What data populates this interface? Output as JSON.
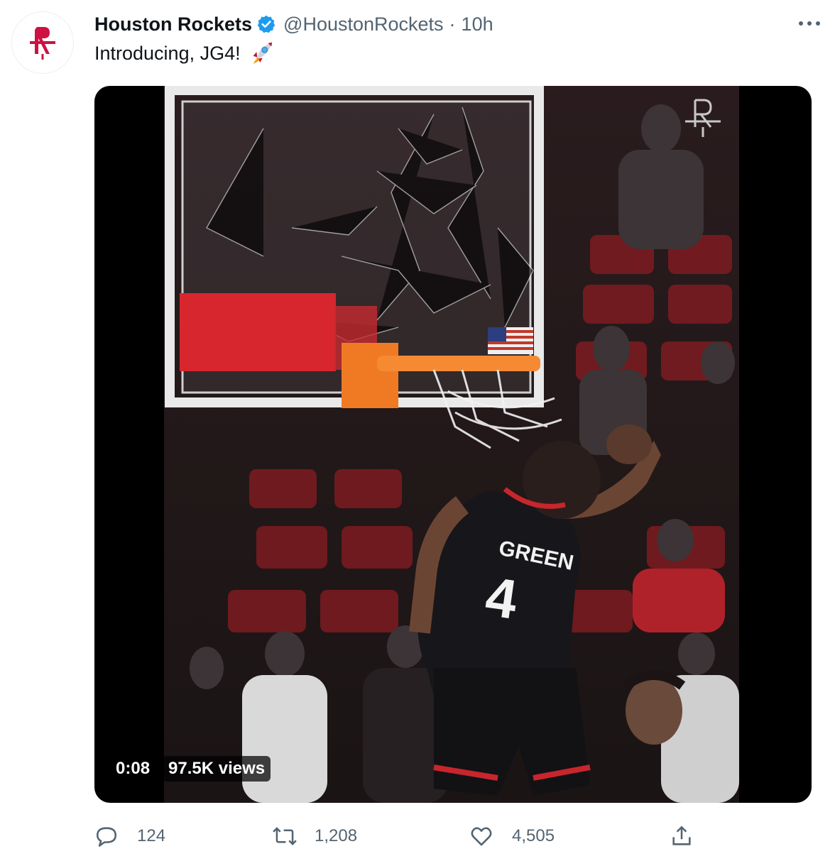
{
  "tweet": {
    "display_name": "Houston Rockets",
    "handle": "@HoustonRockets",
    "separator": "·",
    "time": "10h",
    "text": "Introducing, JG4!",
    "emoji_icon": "rocket-emoji",
    "verified_icon": "verified-badge-icon",
    "more_icon": "more-options-icon"
  },
  "media": {
    "type": "video",
    "elapsed": "0:08",
    "views": "97.5K views",
    "jersey_name": "GREEN",
    "jersey_number": "4"
  },
  "actions": {
    "reply": {
      "icon": "reply-icon",
      "count": "124"
    },
    "retweet": {
      "icon": "retweet-icon",
      "count": "1,208"
    },
    "like": {
      "icon": "heart-icon",
      "count": "4,505"
    },
    "share": {
      "icon": "share-icon"
    }
  },
  "colors": {
    "rockets_red": "#ce1141",
    "verified_blue": "#1d9bf0",
    "text_primary": "#0f1419",
    "text_secondary": "#536471"
  }
}
